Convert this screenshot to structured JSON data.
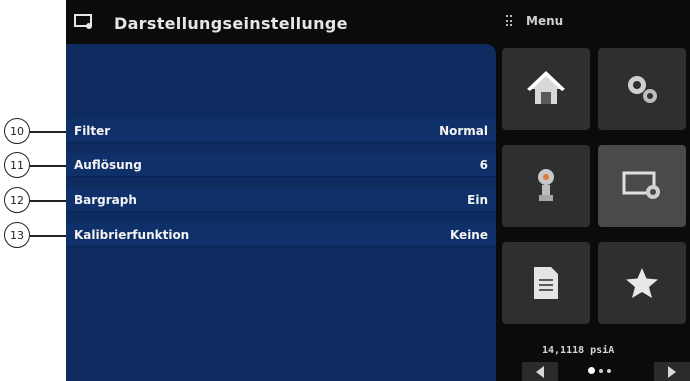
{
  "screen": {
    "title": "Darstellungseinstellunge",
    "menu_label": "Menu",
    "status": "14,1118 psiA"
  },
  "settings": [
    {
      "callout": "10",
      "label": "Filter",
      "value": "Normal"
    },
    {
      "callout": "11",
      "label": "Auflösung",
      "value": "6"
    },
    {
      "callout": "12",
      "label": "Bargraph",
      "value": "Ein"
    },
    {
      "callout": "13",
      "label": "Kalibrierfunktion",
      "value": "Keine"
    }
  ],
  "tiles": [
    {
      "icon": "home-icon"
    },
    {
      "icon": "settings-gears-icon"
    },
    {
      "icon": "sensor-icon"
    },
    {
      "icon": "display-settings-icon",
      "active": true
    },
    {
      "icon": "document-icon"
    },
    {
      "icon": "favorite-star-icon"
    }
  ],
  "colors": {
    "panel": "#0d2b5e",
    "tile": "#2f2f2f",
    "tile_active": "#4a4a4a",
    "screen_bg": "#0b0b0b"
  }
}
